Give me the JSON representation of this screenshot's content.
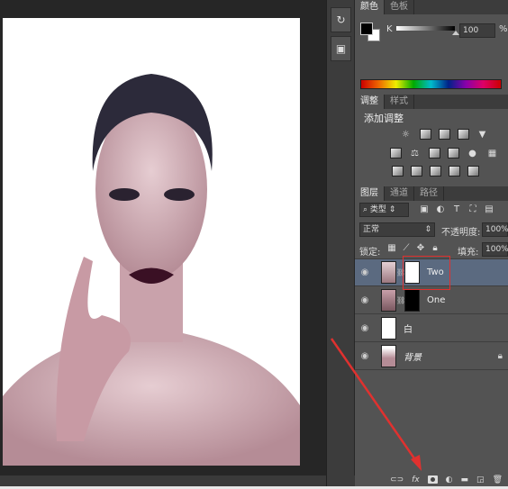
{
  "colors": {
    "accent_red": "#e0312f",
    "selected_layer": "#5b6a80",
    "panel_bg": "#535353"
  },
  "tools": [
    {
      "icon": "history-icon"
    },
    {
      "icon": "actions-icon"
    }
  ],
  "color_panel": {
    "tabs": [
      "颜色",
      "色板"
    ],
    "channel": "K",
    "value": "100",
    "unit": "%",
    "slider_fraction": 1.0
  },
  "adjust_panel": {
    "tabs": [
      "调整",
      "样式"
    ],
    "heading": "添加调整"
  },
  "layers_panel": {
    "tabs": [
      "图层",
      "通道",
      "路径"
    ],
    "filter": "类型",
    "blend_mode": "正常",
    "opacity_label": "不透明度:",
    "opacity": "100%",
    "lock_label": "锁定:",
    "fill_label": "填充:",
    "fill": "100%",
    "layers": [
      {
        "name": "Two",
        "selected": true,
        "mask": "white"
      },
      {
        "name": "One",
        "selected": false,
        "mask": "black"
      },
      {
        "name": "白",
        "selected": false
      },
      {
        "name": "背景",
        "selected": false,
        "locked": true
      }
    ],
    "bottom_icons": [
      "link-icon",
      "fx-icon",
      "add-mask-icon",
      "adjustment-layer-icon",
      "folder-icon",
      "new-layer-icon",
      "trash-icon"
    ],
    "fx_label": "fx"
  }
}
